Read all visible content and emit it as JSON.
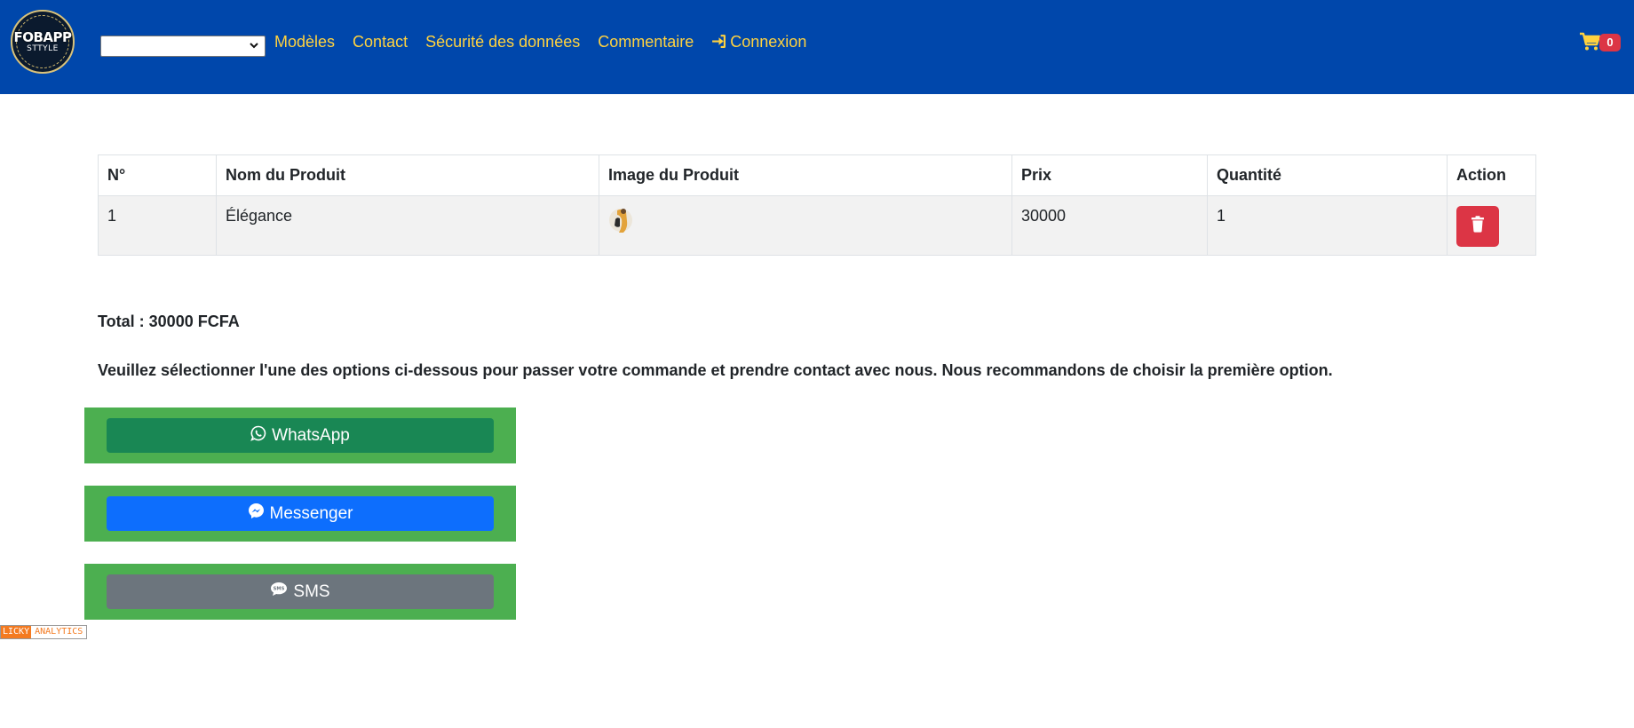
{
  "header": {
    "logo": {
      "line1": "FOBAPP",
      "line2": "STTYLE"
    },
    "select": {
      "value": ""
    },
    "nav": [
      {
        "label": "Modèles"
      },
      {
        "label": "Contact"
      },
      {
        "label": "Sécurité des données"
      },
      {
        "label": "Commentaire"
      },
      {
        "label": "Connexion",
        "icon": "sign-in-icon"
      }
    ],
    "cart": {
      "count": "0",
      "icon": "shopping-cart-icon"
    }
  },
  "table": {
    "headers": [
      "N°",
      "Nom du Produit",
      "Image du Produit",
      "Prix",
      "Quantité",
      "Action"
    ],
    "rows": [
      {
        "n": "1",
        "name": "Élégance",
        "image": "product-thumbnail",
        "price": "30000",
        "qty": "1",
        "action": "trash-icon"
      }
    ]
  },
  "total": "Total : 30000 FCFA",
  "instructions": "Veuillez sélectionner l'une des options ci-dessous pour passer votre commande et prendre contact avec nous. Nous recommandons de choisir la première option.",
  "options": [
    {
      "label": "WhatsApp",
      "icon": "whatsapp-icon",
      "color": "#198754"
    },
    {
      "label": "Messenger",
      "icon": "messenger-icon",
      "color": "#0d6efd"
    },
    {
      "label": "SMS",
      "icon": "sms-icon",
      "color": "#6c757d"
    }
  ],
  "footer_badge": {
    "part1": "LICKY",
    "part2": "ANALYTICS"
  },
  "colors": {
    "navbar": "#0047ab",
    "nav_link": "#ffd23f",
    "danger": "#dc3545",
    "option_box": "#4caf50"
  }
}
